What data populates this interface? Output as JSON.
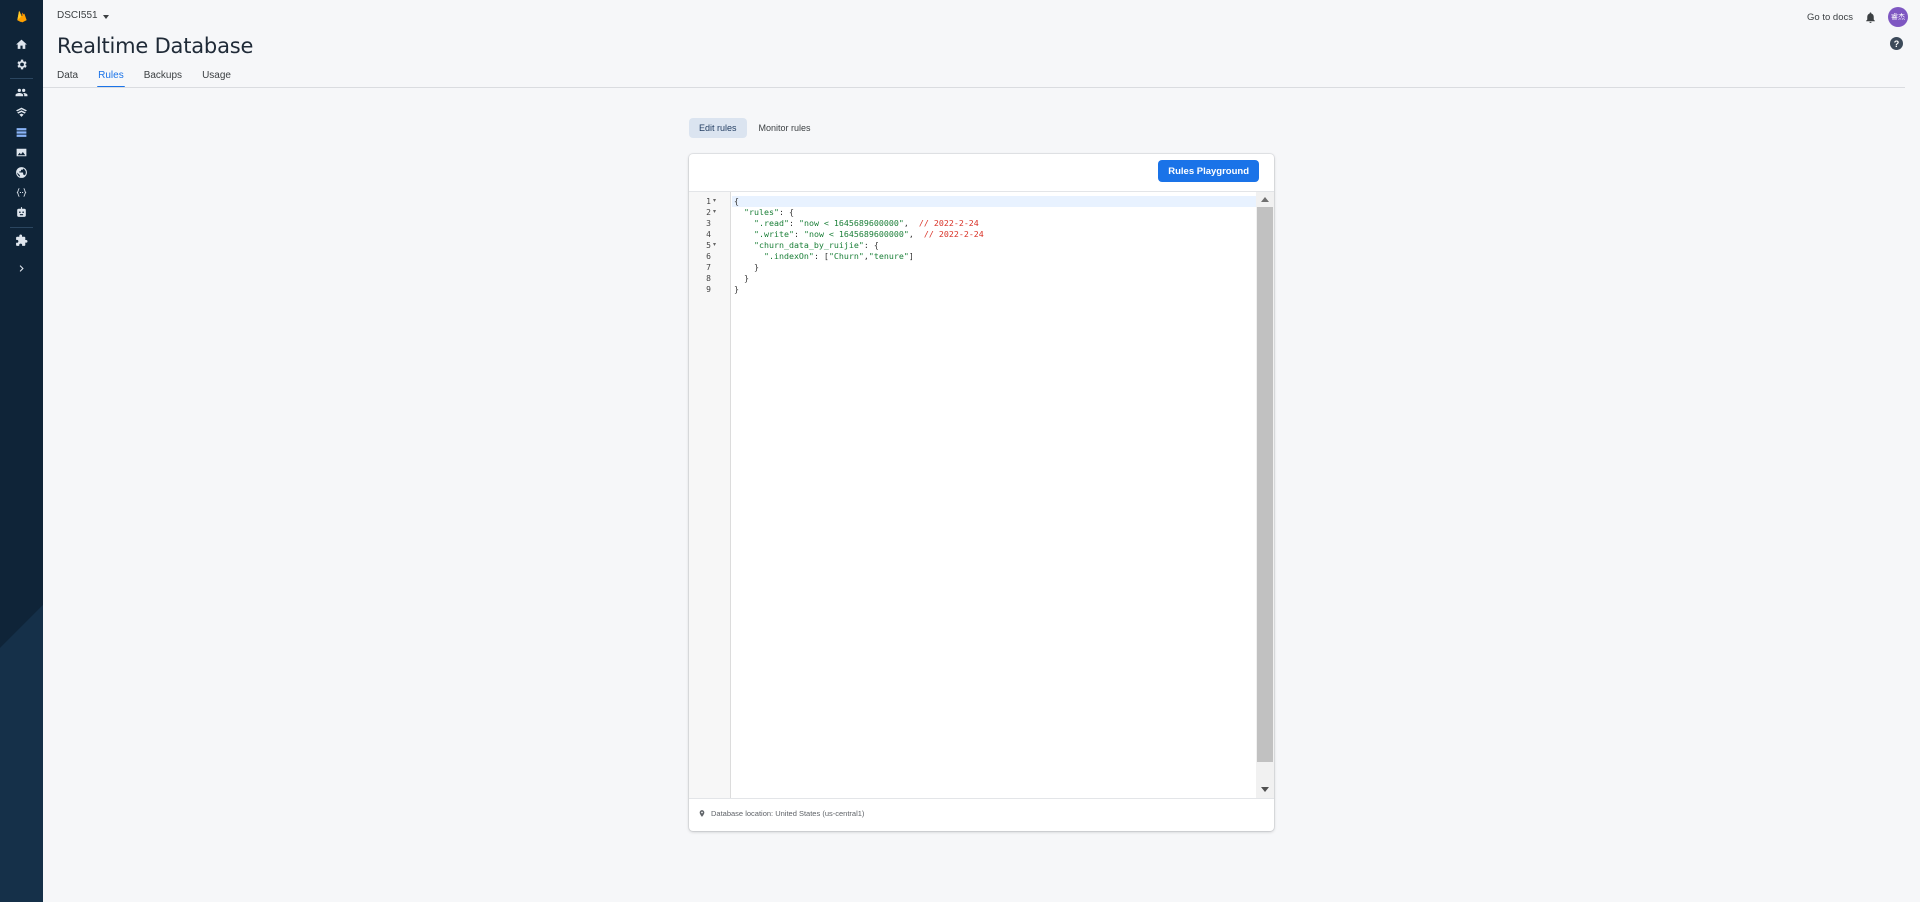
{
  "rail": {
    "items": [
      {
        "icon": "firebase-logo-icon"
      },
      {
        "icon": "home-icon"
      },
      {
        "icon": "gear-icon"
      },
      {
        "icon": "authentication-icon"
      },
      {
        "icon": "firestore-icon"
      },
      {
        "icon": "realtime-database-icon",
        "active": true
      },
      {
        "icon": "storage-icon"
      },
      {
        "icon": "hosting-icon"
      },
      {
        "icon": "functions-icon"
      },
      {
        "icon": "ml-icon"
      },
      {
        "icon": "extensions-icon"
      },
      {
        "icon": "expand-chevron-icon"
      }
    ]
  },
  "header": {
    "project_name": "DSCI551",
    "docs_link": "Go to docs",
    "avatar_initials": "睿杰",
    "title": "Realtime Database"
  },
  "tabs": [
    {
      "label": "Data"
    },
    {
      "label": "Rules",
      "active": true
    },
    {
      "label": "Backups"
    },
    {
      "label": "Usage"
    }
  ],
  "modes": {
    "edit": "Edit rules",
    "monitor": "Monitor rules"
  },
  "card": {
    "playground_button": "Rules Playground",
    "location": "Database location: United States (us-central1)"
  },
  "editor": {
    "lines": [
      {
        "num": "1",
        "fold": true,
        "tokens": [
          {
            "t": "{",
            "c": "punc"
          }
        ]
      },
      {
        "num": "2",
        "fold": true,
        "tokens": [
          {
            "t": "  \"rules\"",
            "c": "key"
          },
          {
            "t": ": {",
            "c": "punc"
          }
        ]
      },
      {
        "num": "3",
        "fold": false,
        "tokens": [
          {
            "t": "    \".read\"",
            "c": "key"
          },
          {
            "t": ": ",
            "c": "punc"
          },
          {
            "t": "\"now < 1645689600000\"",
            "c": "str"
          },
          {
            "t": ",  ",
            "c": "punc"
          },
          {
            "t": "// 2022-2-24",
            "c": "com"
          }
        ]
      },
      {
        "num": "4",
        "fold": false,
        "tokens": [
          {
            "t": "    \".write\"",
            "c": "key"
          },
          {
            "t": ": ",
            "c": "punc"
          },
          {
            "t": "\"now < 1645689600000\"",
            "c": "str"
          },
          {
            "t": ",  ",
            "c": "punc"
          },
          {
            "t": "// 2022-2-24",
            "c": "com"
          }
        ]
      },
      {
        "num": "5",
        "fold": true,
        "tokens": [
          {
            "t": "    \"churn_data_by_ruijie\"",
            "c": "key"
          },
          {
            "t": ": {",
            "c": "punc"
          }
        ]
      },
      {
        "num": "6",
        "fold": false,
        "tokens": [
          {
            "t": "      \".indexOn\"",
            "c": "key"
          },
          {
            "t": ": [",
            "c": "punc"
          },
          {
            "t": "\"Churn\"",
            "c": "str"
          },
          {
            "t": ",",
            "c": "punc"
          },
          {
            "t": "\"tenure\"",
            "c": "str"
          },
          {
            "t": "]",
            "c": "punc"
          }
        ]
      },
      {
        "num": "7",
        "fold": false,
        "tokens": [
          {
            "t": "    }",
            "c": "punc"
          }
        ]
      },
      {
        "num": "8",
        "fold": false,
        "tokens": [
          {
            "t": "  }",
            "c": "punc"
          }
        ]
      },
      {
        "num": "9",
        "fold": false,
        "tokens": [
          {
            "t": "}",
            "c": "punc"
          }
        ]
      }
    ]
  }
}
